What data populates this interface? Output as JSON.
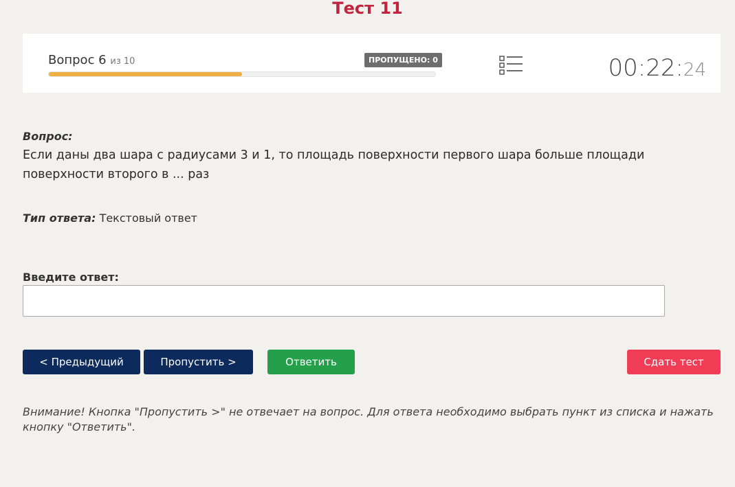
{
  "page": {
    "title": "Тест 11"
  },
  "header": {
    "question_label": "Вопрос 6",
    "question_of": "из 10",
    "skipped_badge": "ПРОПУЩЕНО: 0",
    "progress_fraction": 0.5,
    "timer_main": "00:22:",
    "timer_seconds": "24",
    "list_icon": "question-list-icon"
  },
  "question": {
    "label": "Вопрос:",
    "text": "Если даны два шара с радиусами 3 и 1, то площадь поверхности первого шара больше площади поверхности второго в ... раз"
  },
  "answer_type": {
    "label": "Тип ответа:",
    "value": "Текстовый ответ"
  },
  "answer_input": {
    "label": "Введите ответ:",
    "value": "",
    "placeholder": ""
  },
  "buttons": {
    "prev": "< Предыдущий",
    "skip": "Пропустить >",
    "answer": "Ответить",
    "finish": "Сдать тест"
  },
  "notice": "Внимание! Кнопка \"Пропустить >\" не отвечает на вопрос. Для ответа необходимо выбрать пункт из списка и нажать кнопку \"Ответить\".",
  "colors": {
    "title": "#c2243f",
    "progress": "#efae44",
    "primary_button": "#0d2a5c",
    "answer_button": "#24a04a",
    "finish_button": "#f03d55"
  }
}
